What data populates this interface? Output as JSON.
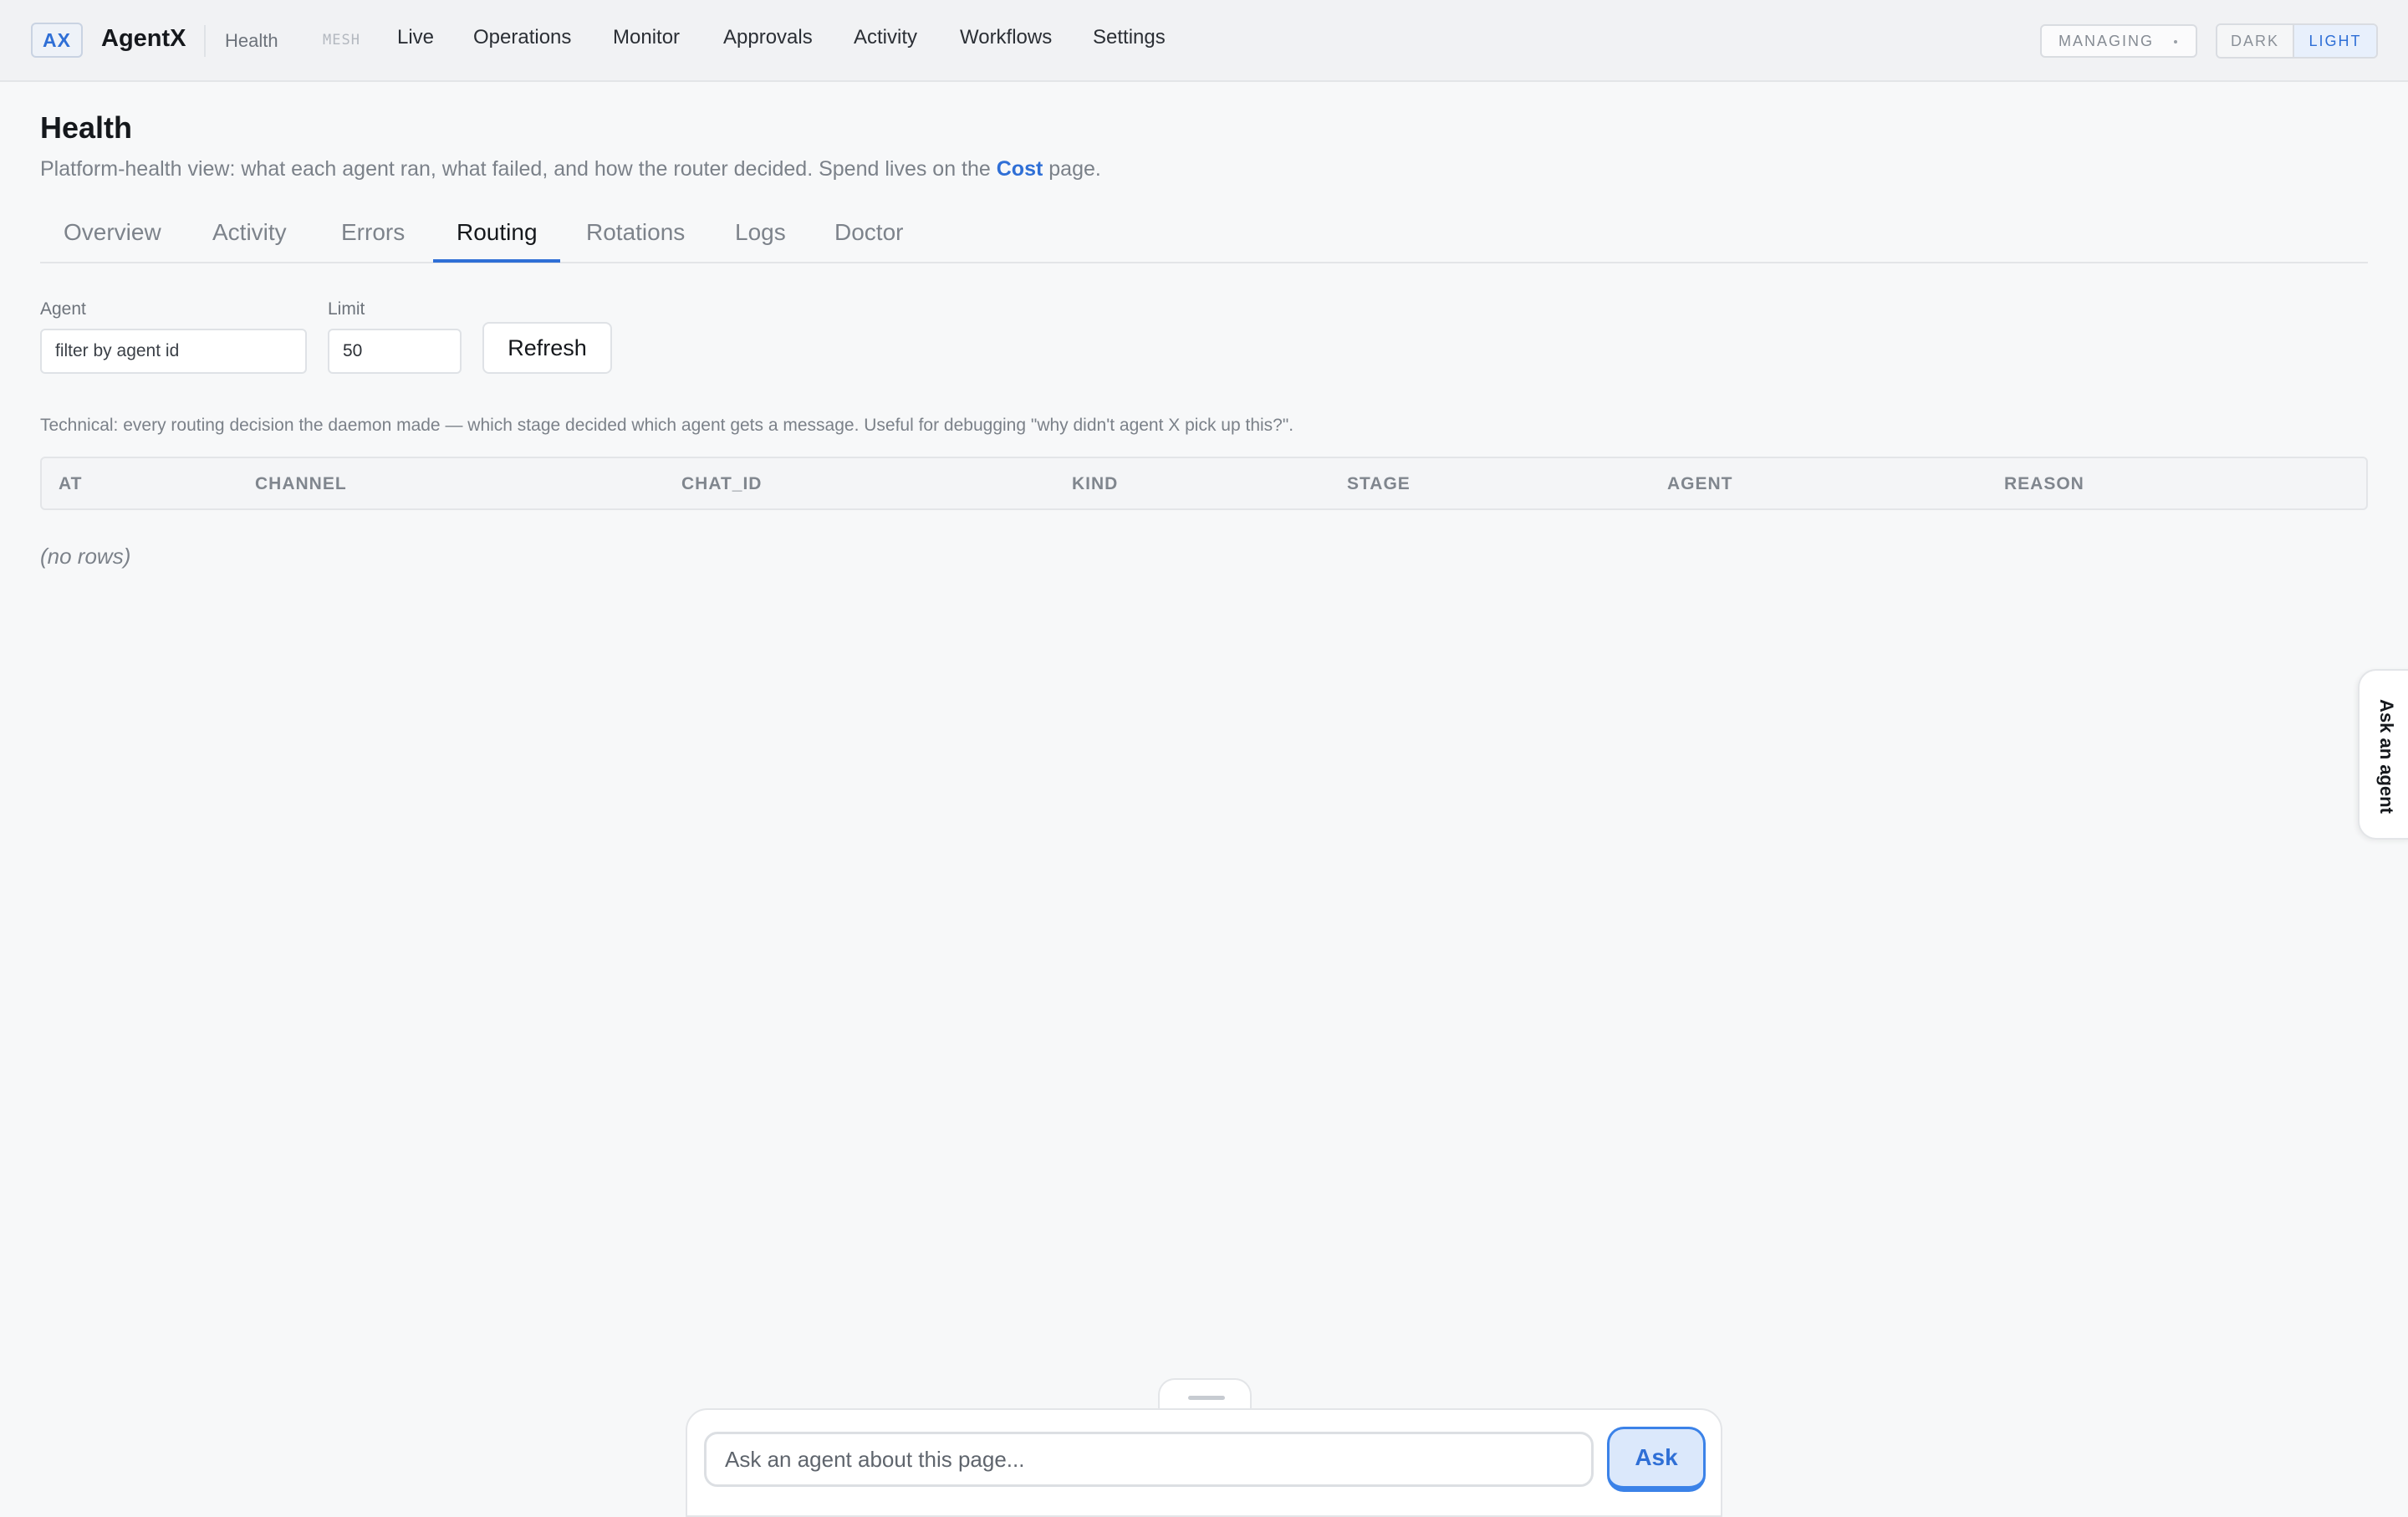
{
  "brand": {
    "logo_text": "AX",
    "app_name": "AgentX",
    "section": "Health",
    "mesh_label": "MESH"
  },
  "nav": {
    "items": [
      {
        "label": "Live"
      },
      {
        "label": "Operations"
      },
      {
        "label": "Monitor"
      },
      {
        "label": "Approvals"
      },
      {
        "label": "Activity"
      },
      {
        "label": "Workflows"
      },
      {
        "label": "Settings"
      }
    ]
  },
  "controls": {
    "managing_label": "MANAGING",
    "theme_dark": "DARK",
    "theme_light": "LIGHT",
    "active_theme": "LIGHT"
  },
  "page": {
    "title": "Health",
    "subtitle_prefix": "Platform-health view: what each agent ran, what failed, and how the router decided. Spend lives on the ",
    "subtitle_link": "Cost",
    "subtitle_suffix": " page."
  },
  "tabs": {
    "items": [
      {
        "label": "Overview"
      },
      {
        "label": "Activity"
      },
      {
        "label": "Errors"
      },
      {
        "label": "Routing"
      },
      {
        "label": "Rotations"
      },
      {
        "label": "Logs"
      },
      {
        "label": "Doctor"
      }
    ],
    "active": "Routing"
  },
  "filters": {
    "agent_label": "Agent",
    "agent_placeholder": "filter by agent id",
    "agent_value": "",
    "limit_label": "Limit",
    "limit_value": "50",
    "refresh_label": "Refresh"
  },
  "technical_note": "Technical: every routing decision the daemon made — which stage decided which agent gets a message. Useful for debugging \"why didn't agent X pick up this?\".",
  "table": {
    "columns": [
      "AT",
      "CHANNEL",
      "CHAT_ID",
      "KIND",
      "STAGE",
      "AGENT",
      "REASON"
    ],
    "rows": [],
    "empty_text": "(no rows)"
  },
  "side_tab": {
    "label": "Ask an agent"
  },
  "ask_bar": {
    "placeholder": "Ask an agent about this page...",
    "button_label": "Ask"
  },
  "colors": {
    "accent": "#2f6fd6",
    "background": "#f7f8f9",
    "topbar": "#f1f2f4"
  }
}
